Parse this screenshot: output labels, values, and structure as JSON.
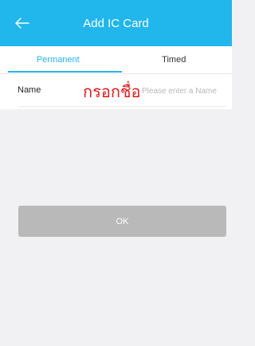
{
  "header": {
    "back_icon": "arrow-left-icon",
    "title": "Add IC Card",
    "background_color": "#21b6ec"
  },
  "tabs": [
    {
      "label": "Permanent",
      "selected": true
    },
    {
      "label": "Timed",
      "selected": false
    }
  ],
  "form": {
    "name_label": "Name",
    "handwritten_annotation": "กรอกชื่อ",
    "name_value": "",
    "name_placeholder": "Please enter a Name"
  },
  "actions": {
    "ok_label": "OK"
  },
  "colors": {
    "accent": "#21b6ec",
    "annotation": "#e01b1b",
    "button_disabled": "#b9b9b9"
  }
}
